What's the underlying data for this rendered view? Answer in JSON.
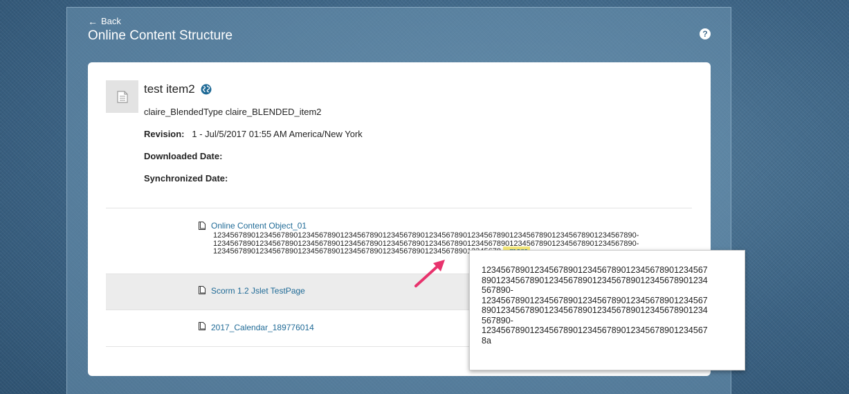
{
  "header": {
    "back_label": "Back",
    "title": "Online Content Structure",
    "help_label": "?"
  },
  "item": {
    "title": "test item2",
    "subtype": "claire_BlendedType claire_BLENDED_item2",
    "revision_label": "Revision:",
    "revision_value": "1 - Jul/5/2017 01:55 AM America/New York",
    "downloaded_label": "Downloaded Date:",
    "downloaded_value": "",
    "synchronized_label": "Synchronized Date:",
    "synchronized_value": ""
  },
  "objects": [
    {
      "name": "Online Content Object_01",
      "description_lines": [
        "1234567890123456789012345678901234567890123456789012345678901234567890123456789012345678901234567890-",
        "1234567890123456789012345678901234567890123456789012345678901234567890123456789012345678901234567890-",
        "12345678901234567890123456789012345678901234567890123456789012345678."
      ],
      "more_prefix": "..",
      "more_label": "more"
    },
    {
      "name": "Scorm 1.2 Jslet TestPage"
    },
    {
      "name": "2017_Calendar_189776014"
    }
  ],
  "popup": {
    "lines": [
      "12345678901234567890123456789012345678901234567",
      "89012345678901234567890123456789012345678901234",
      "567890-",
      "12345678901234567890123456789012345678901234567",
      "89012345678901234567890123456789012345678901234",
      "567890-",
      "12345678901234567890123456789012345678901234567",
      "8a"
    ]
  },
  "icons": {
    "back": "left-arrow-icon",
    "help": "help-icon",
    "thumbnail": "document-icon",
    "language": "globe-icon",
    "object": "file-icon",
    "annotation": "pink-arrow-icon"
  },
  "colors": {
    "link": "#1f6a96",
    "highlight": "#f6ea7a",
    "annotation_arrow": "#e8336d"
  }
}
